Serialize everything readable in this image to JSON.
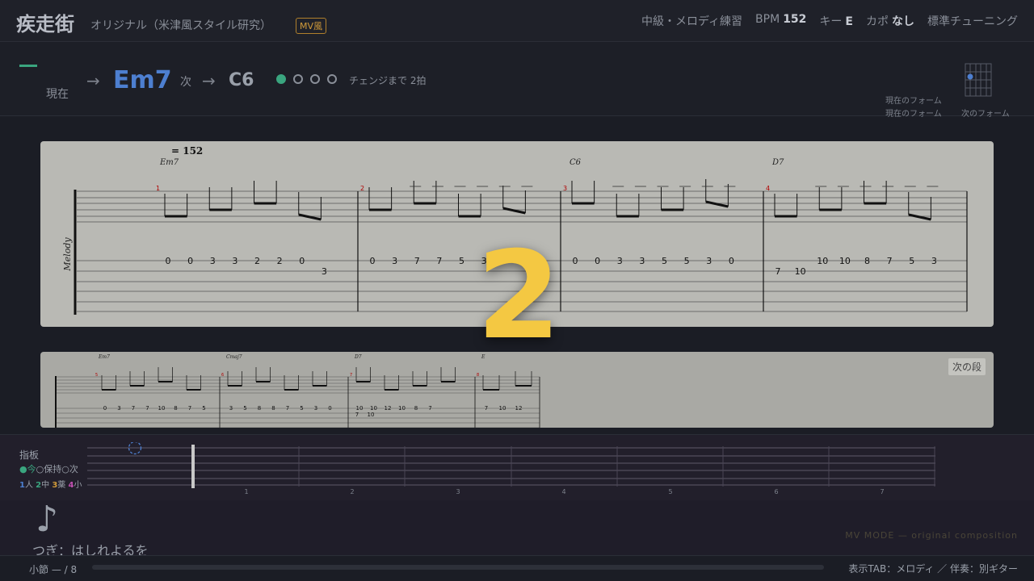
{
  "header": {
    "title": "疾走街",
    "subtitle": "オリジナル（米津風スタイル研究）",
    "badge": "MV風",
    "level": "中級・メロディ練習",
    "bpm_label": "BPM",
    "bpm_value": "152",
    "key_label": "キー",
    "key_value": "E",
    "capo_label": "カポ",
    "capo_value": "なし",
    "tuning": "標準チューニング"
  },
  "chord_bar": {
    "now_label": "現在",
    "arrow": "→",
    "current_chord": "Em7",
    "next_label": "次",
    "next_chord": "C6",
    "beats_total": 4,
    "beats_active": 1,
    "change_text": "チェンジまで 2拍",
    "form_current": "現在のフォーム",
    "form_next": "次のフォーム",
    "accent_color": "#4d7fd0",
    "beat_color": "#3aa57f"
  },
  "score": {
    "tempo": "= 152",
    "track_label": "Melody",
    "chords": [
      "Em7",
      "C6",
      "D7"
    ],
    "measures": [
      {
        "number": "1",
        "high": [
          "0",
          "0",
          "3",
          "3",
          "2",
          "2",
          "0"
        ],
        "low": [
          "3"
        ]
      },
      {
        "number": "2",
        "high": [
          "0",
          "3",
          "7",
          "7",
          "5",
          "3"
        ],
        "low": []
      },
      {
        "number": "3",
        "high": [
          "0",
          "0",
          "3",
          "3",
          "5",
          "5",
          "3",
          "0"
        ],
        "low": []
      },
      {
        "number": "4",
        "high": [
          "10",
          "10",
          "8",
          "7",
          "5",
          "3"
        ],
        "low": [
          "7",
          "10"
        ]
      }
    ]
  },
  "score_next": {
    "label": "次の段",
    "chords": [
      "Em7",
      "Cmaj7",
      "D7",
      "E"
    ],
    "measures": [
      {
        "number": "5",
        "high": [
          "0",
          "3",
          "7",
          "7",
          "10",
          "8",
          "7",
          "5"
        ],
        "low": []
      },
      {
        "number": "6",
        "high": [
          "3",
          "5",
          "8",
          "8",
          "7",
          "5",
          "3",
          "0"
        ],
        "low": []
      },
      {
        "number": "7",
        "high": [
          "10",
          "10",
          "12",
          "10",
          "8",
          "7"
        ],
        "low": [
          "7",
          "10"
        ]
      },
      {
        "number": "8",
        "high": [
          "7",
          "10",
          "12"
        ],
        "low": []
      }
    ]
  },
  "countdown": "2",
  "fretboard": {
    "title": "指板",
    "legend_now": "●今",
    "legend_hold": "○保持",
    "legend_next": "○次",
    "finger_1": "1",
    "finger_1_label": "人",
    "finger_2": "2",
    "finger_2_label": "中",
    "finger_3": "3",
    "finger_3_label": "薬",
    "finger_4": "4",
    "finger_4_label": "小",
    "fret_numbers": [
      "1",
      "2",
      "3",
      "4",
      "5",
      "6",
      "7"
    ]
  },
  "lyric": {
    "icon": "♪",
    "next": "つぎ：はしれよるを"
  },
  "mv_mode": "MV MODE — original composition",
  "footer": {
    "measure": "小節 — / 8",
    "progress": 0,
    "display": "表示TAB：メロディ ／ 伴奏：別ギター"
  }
}
